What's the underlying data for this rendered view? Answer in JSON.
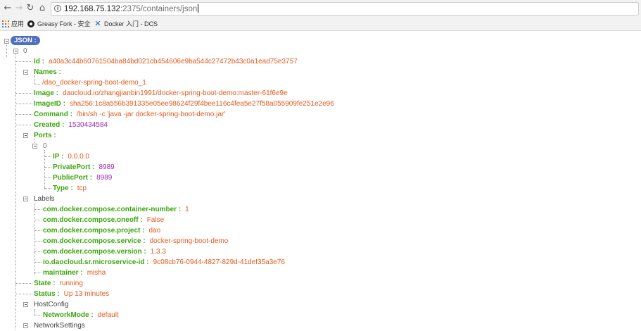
{
  "browser": {
    "url_host": "192.168.75.132",
    "url_path": ":2375/containers/json"
  },
  "bookmarks": [
    {
      "label": "应用"
    },
    {
      "label": "Greasy Fork - 安全"
    },
    {
      "label": "Docker 入门 - DCS"
    }
  ],
  "json": {
    "root_label": "JSON :",
    "index0": "0",
    "id": {
      "key": "Id :",
      "value": "a40a3c44b60761504ba84bd021cb454606e9ba544c27472b43c0a1ead75e3757"
    },
    "names": {
      "key": "Names :",
      "values": [
        "/dao_docker-spring-boot-demo_1"
      ]
    },
    "image": {
      "key": "Image :",
      "value": "daocloud.io/zhangjianbin1991/docker-spring-boot-demo:master-61f6e9e"
    },
    "image_id": {
      "key": "ImageID :",
      "value": "sha256:1c8a556b391335e05ee98624f29f4bee116c4fea5e27f58a055909fe251e2e96"
    },
    "command": {
      "key": "Command :",
      "value": "/bin/sh -c 'java -jar docker-spring-boot-demo.jar'"
    },
    "created": {
      "key": "Created :",
      "value": "1530434584"
    },
    "ports": {
      "key": "Ports :",
      "index0": "0",
      "fields": [
        {
          "key": "IP :",
          "value": "0.0.0.0",
          "type": "string"
        },
        {
          "key": "PrivatePort :",
          "value": "8989",
          "type": "number"
        },
        {
          "key": "PublicPort :",
          "value": "8989",
          "type": "number"
        },
        {
          "key": "Type :",
          "value": "tcp",
          "type": "string"
        }
      ]
    },
    "labels": {
      "key": "Labels",
      "fields": [
        {
          "key": "com.docker.compose.container-number :",
          "value": "1"
        },
        {
          "key": "com.docker.compose.oneoff :",
          "value": "False"
        },
        {
          "key": "com.docker.compose.project :",
          "value": "dao"
        },
        {
          "key": "com.docker.compose.service :",
          "value": "docker-spring-boot-demo"
        },
        {
          "key": "com.docker.compose.version :",
          "value": "1.3.3"
        },
        {
          "key": "io.daocloud.sr.microservice-id :",
          "value": "9c08cb76-0944-4827-829d-41def35a3e76"
        },
        {
          "key": "maintainer :",
          "value": "misha"
        }
      ]
    },
    "state": {
      "key": "State :",
      "value": "running"
    },
    "status": {
      "key": "Status :",
      "value": "Up 13 minutes"
    },
    "host_config": {
      "key": "HostConfig",
      "network_mode": {
        "key": "NetworkMode :",
        "value": "default"
      }
    },
    "network_settings": {
      "key": "NetworkSettings"
    }
  },
  "colors": {
    "key": "#3aa60c",
    "string": "#e35a1c",
    "number": "#9a2ab8",
    "root_badge": "#4e6fc2"
  },
  "icons": [
    "back-arrow-icon",
    "forward-arrow-icon",
    "reload-icon",
    "home-icon",
    "info-icon",
    "apps-grid-icon",
    "greasy-fork-icon",
    "docker-icon"
  ]
}
